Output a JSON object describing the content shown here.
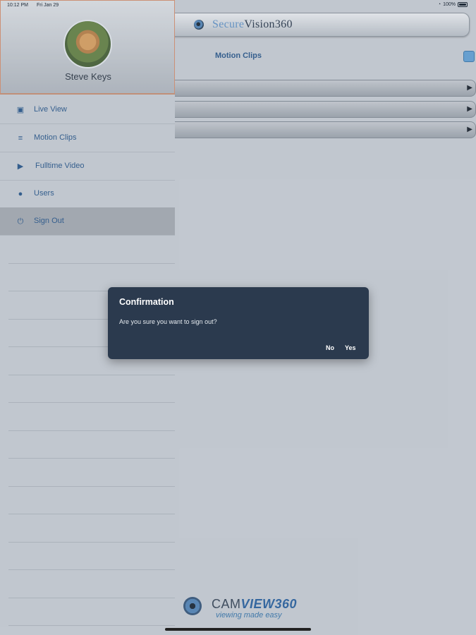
{
  "status": {
    "time": "10:12 PM",
    "date": "Fri Jan 29",
    "battery": "100%"
  },
  "header": {
    "brand_prefix": "Secure",
    "brand_main": "Vision360",
    "page_title": "Motion Clips"
  },
  "profile": {
    "name": "Steve Keys"
  },
  "menu": {
    "items": [
      {
        "label": "Live View",
        "icon": "camera-icon"
      },
      {
        "label": "Motion Clips",
        "icon": "layers-icon"
      },
      {
        "label": "Fulltime Video",
        "icon": "video-icon"
      },
      {
        "label": "Users",
        "icon": "user-icon"
      },
      {
        "label": "Sign Out",
        "icon": "power-icon",
        "active": true
      }
    ]
  },
  "dialog": {
    "title": "Confirmation",
    "message": "Are you sure you want to sign out?",
    "no_label": "No",
    "yes_label": "Yes"
  },
  "footer": {
    "brand_prefix": "CAM",
    "brand_main": "VIEW360",
    "tagline": "viewing made easy"
  },
  "colors": {
    "accent": "#1d4f86",
    "dialog_bg": "#2b3a4e",
    "active_item": "#a3a9b0"
  }
}
